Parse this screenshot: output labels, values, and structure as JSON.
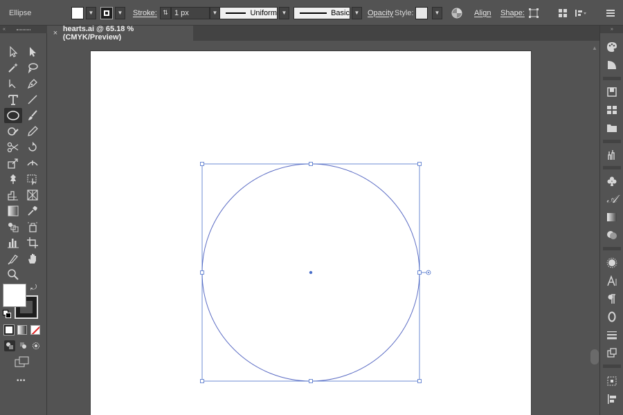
{
  "control_bar": {
    "selection_label": "Ellipse",
    "stroke_label": "Stroke:",
    "stroke_weight": "1 px",
    "variable_width_profile": "Uniform",
    "brush_definition": "Basic",
    "opacity_label": "Opacity",
    "style_label": "Style:",
    "align_label": "Align",
    "shape_label": "Shape:"
  },
  "document": {
    "tab_title": "hearts.ai @ 65.18 % (CMYK/Preview)",
    "close_glyph": "×"
  },
  "toolbar": {
    "more_tools_glyph": "•••",
    "active_tool": "ellipse-tool"
  },
  "colors": {
    "fill": "#ffffff",
    "stroke": "#1e1e1e",
    "selection": "#4a6fc9",
    "interface": "#535353"
  }
}
